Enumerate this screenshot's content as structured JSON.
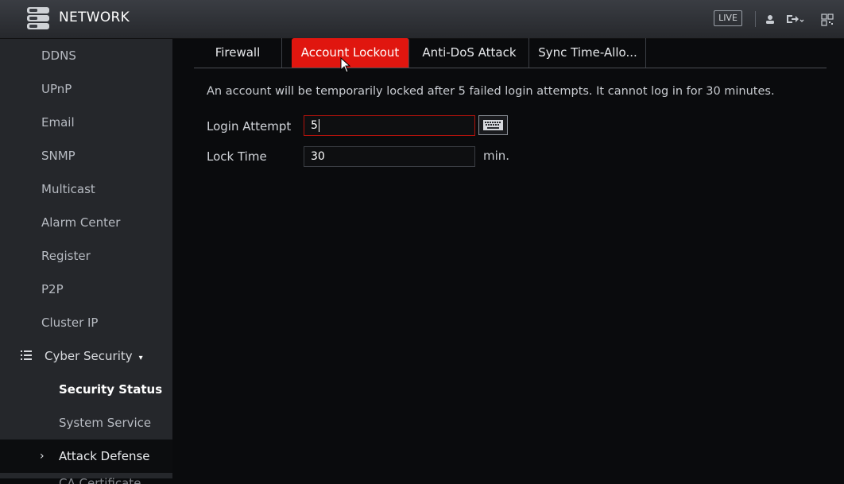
{
  "header": {
    "title": "NETWORK",
    "live_label": "LIVE"
  },
  "sidebar": {
    "items": [
      {
        "label": "DDNS"
      },
      {
        "label": "UPnP"
      },
      {
        "label": "Email"
      },
      {
        "label": "SNMP"
      },
      {
        "label": "Multicast"
      },
      {
        "label": "Alarm Center"
      },
      {
        "label": "Register"
      },
      {
        "label": "P2P"
      },
      {
        "label": "Cluster IP"
      },
      {
        "label": "Cyber Security"
      },
      {
        "label": "Security Status"
      },
      {
        "label": "System Service"
      },
      {
        "label": "Attack Defense"
      },
      {
        "label": "CA Certificate"
      }
    ],
    "expand_chevron": "›",
    "collapse_caret": "▾"
  },
  "tabs": [
    {
      "label": "Firewall"
    },
    {
      "label": "Account Lockout"
    },
    {
      "label": "Anti-DoS Attack"
    },
    {
      "label": "Sync Time-Allo..."
    }
  ],
  "main": {
    "description": "An account will be temporarily locked after 5 failed login attempts. It cannot log in for 30 minutes.",
    "login_attempt": {
      "label": "Login Attempt",
      "value": "5"
    },
    "lock_time": {
      "label": "Lock Time",
      "value": "30",
      "unit": "min."
    }
  },
  "colors": {
    "accent": "#e0160f",
    "sidebar_bg": "#25272b",
    "content_bg": "#0a0b0d"
  },
  "icons": [
    "network-logo-icon",
    "user-icon",
    "logout-icon",
    "qr-code-icon",
    "menu-list-icon",
    "keyboard-icon",
    "mouse-pointer-icon"
  ]
}
